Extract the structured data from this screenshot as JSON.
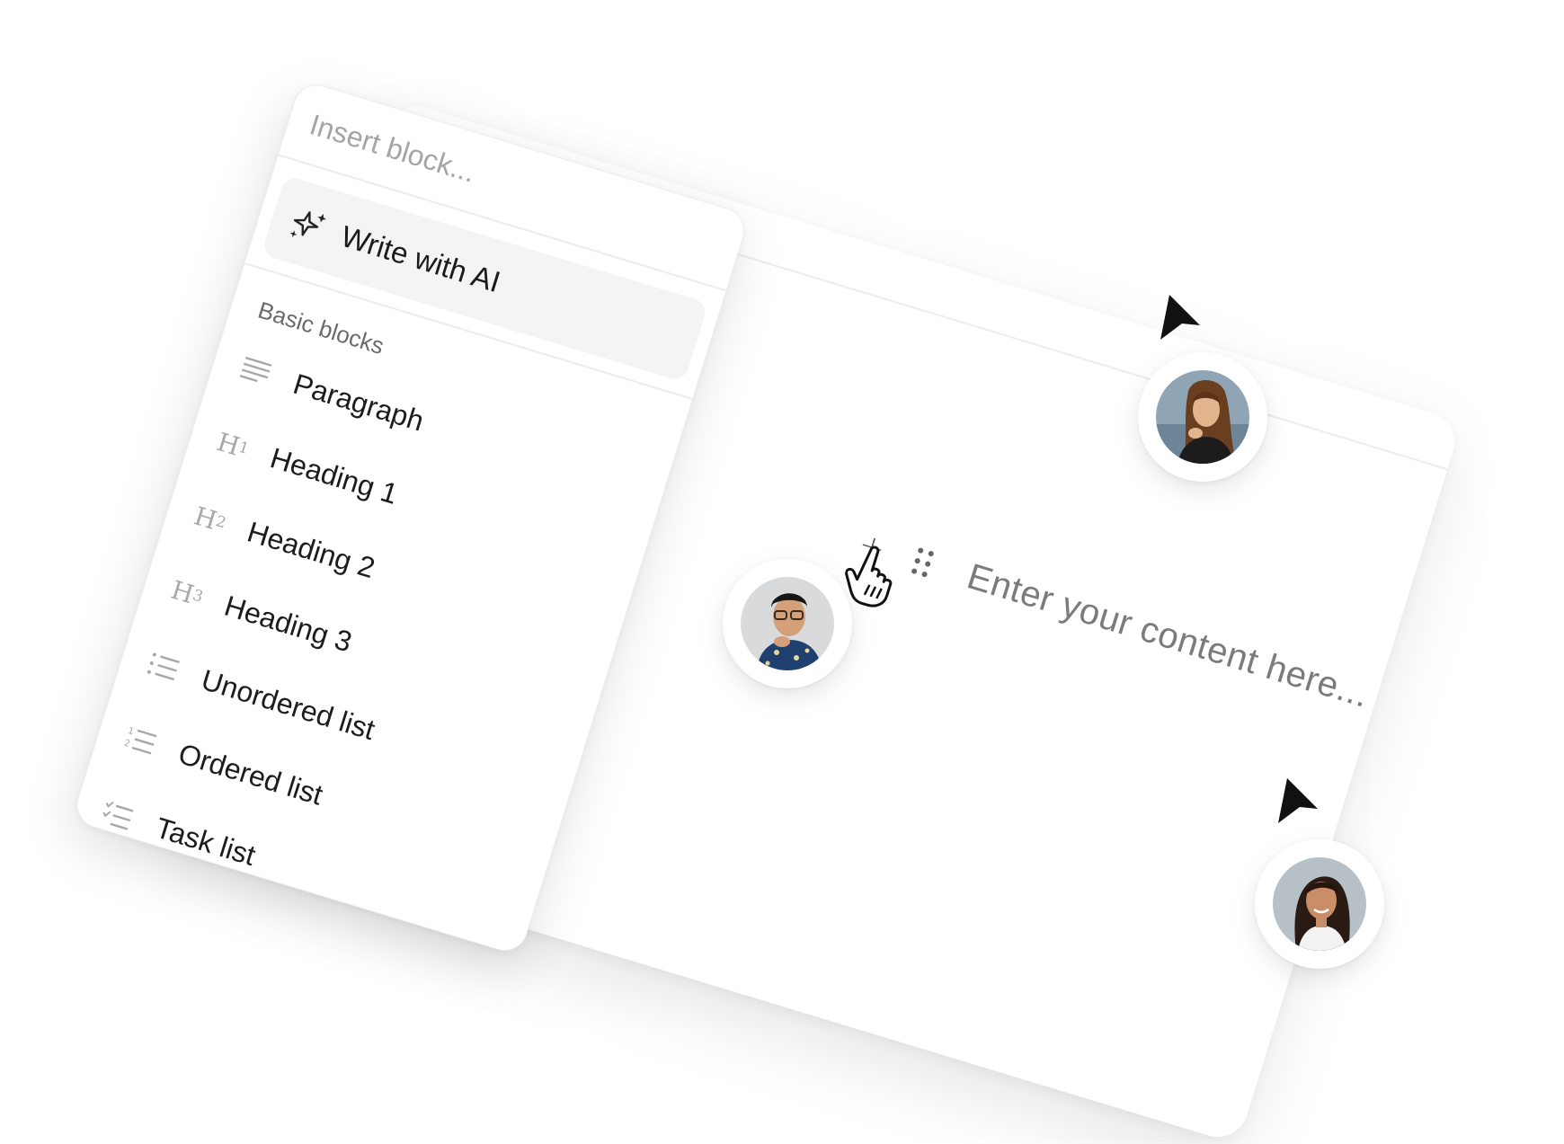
{
  "window": {
    "traffic_lights": [
      "#ee4b45",
      "#f5b52f",
      "#30c73f"
    ]
  },
  "editor": {
    "add_icon": "plus-icon",
    "drag_icon": "grip-icon",
    "placeholder": "Enter your content here..."
  },
  "menu": {
    "search_placeholder": "Insert block...",
    "ai_item": {
      "icon": "sparkles-icon",
      "label": "Write with AI"
    },
    "section_title": "Basic blocks",
    "items": [
      {
        "icon": "paragraph-icon",
        "label": "Paragraph"
      },
      {
        "icon": "heading-1-icon",
        "label": "Heading 1"
      },
      {
        "icon": "heading-2-icon",
        "label": "Heading 2"
      },
      {
        "icon": "heading-3-icon",
        "label": "Heading 3"
      },
      {
        "icon": "unordered-list-icon",
        "label": "Unordered list"
      },
      {
        "icon": "ordered-list-icon",
        "label": "Ordered list"
      },
      {
        "icon": "task-list-icon",
        "label": "Task list"
      }
    ]
  },
  "collaborators": [
    {
      "name_icon": "avatar-woman-long-hair"
    },
    {
      "name_icon": "avatar-man-glasses"
    },
    {
      "name_icon": "avatar-woman-smiling"
    }
  ]
}
